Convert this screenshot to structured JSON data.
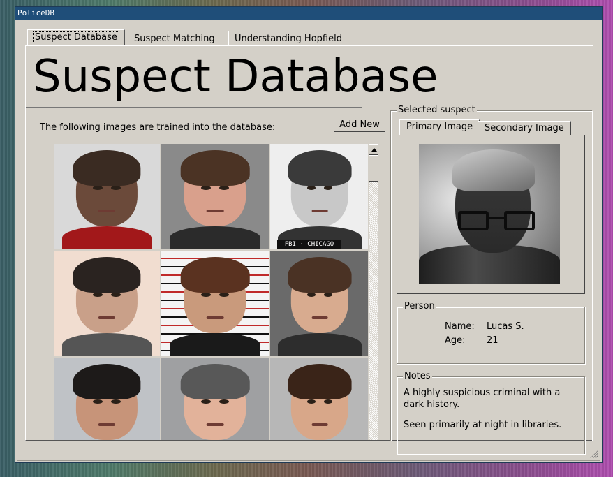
{
  "window": {
    "title": "PoliceDB"
  },
  "main_tabs": [
    {
      "label": "Suspect Database",
      "active": true
    },
    {
      "label": "Suspect Matching",
      "active": false
    },
    {
      "label": "Understanding Hopfield",
      "active": false
    }
  ],
  "page": {
    "title": "Suspect Database",
    "intro": "The following images are trained into the database:",
    "add_new_label": "Add New",
    "plate_text": "FBI · CHICAGO"
  },
  "gallery": {
    "thumbnails": [
      {
        "bg": "#d9d9d9",
        "skin": "#6b4a3a",
        "hair": "#3a2b22",
        "shirt": "#a2181a"
      },
      {
        "bg": "#8a8a8a",
        "skin": "#d9a08c",
        "hair": "#4b3324",
        "shirt": "#2b2b2b"
      },
      {
        "bg": "#eeeeee",
        "skin": "#c8c8c8",
        "hair": "#3a3a3a",
        "shirt": "#333333"
      },
      {
        "bg": "#f1ddd0",
        "skin": "#c9a089",
        "hair": "#2a2320",
        "shirt": "#555555"
      },
      {
        "bg": "stripes",
        "skin": "#c99a7c",
        "hair": "#5a3220",
        "shirt": "#1a1a1a"
      },
      {
        "bg": "#6a6a6a",
        "skin": "#d8ab8f",
        "hair": "#4a3224",
        "shirt": "#2d2d2d"
      },
      {
        "bg": "#bfc2c6",
        "skin": "#c79479",
        "hair": "#1d1a19",
        "shirt": "#222222"
      },
      {
        "bg": "#9fa0a2",
        "skin": "#e2b29a",
        "hair": "#585858",
        "shirt": "#e7e7e7"
      },
      {
        "bg": "#b7b7b7",
        "skin": "#d8a789",
        "hair": "#3a2418",
        "shirt": "#444444"
      }
    ]
  },
  "selected": {
    "group_title": "Selected suspect",
    "tabs": [
      {
        "label": "Primary Image",
        "active": true
      },
      {
        "label": "Secondary Image",
        "active": false
      }
    ]
  },
  "person": {
    "group_title": "Person",
    "name_label": "Name:",
    "name_value": "Lucas S.",
    "age_label": "Age:",
    "age_value": "21"
  },
  "notes": {
    "group_title": "Notes",
    "lines": [
      "A highly suspicious criminal with a dark history.",
      "Seen primarily at night in libraries."
    ]
  }
}
